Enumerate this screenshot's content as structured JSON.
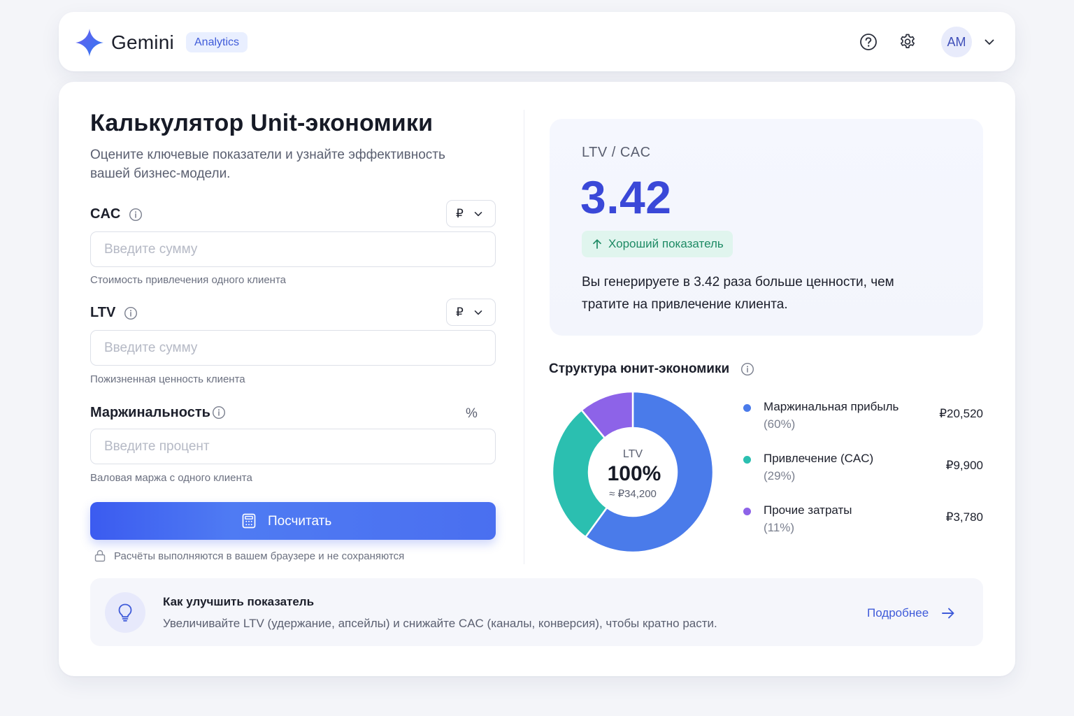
{
  "header": {
    "brand": "Gemini",
    "badge": "Analytics",
    "avatar_initials": "AM",
    "icons": [
      "sparkle-star-icon",
      "help-circle-icon",
      "gear-icon",
      "chevron-down-icon"
    ]
  },
  "calculator": {
    "title": "Калькулятор Unit-экономики",
    "subtitle": "Оцените ключевые показатели и узнайте эффективность вашей бизнес-модели.",
    "fields": [
      {
        "label": "CAC",
        "currency": "₽",
        "value": "",
        "placeholder": "Введите сумму",
        "hint": "Стоимость привлечения одного клиента"
      },
      {
        "label": "LTV",
        "currency": "₽",
        "value": "",
        "placeholder": "Введите сумму",
        "hint": "Пожизненная ценность клиента"
      },
      {
        "label": "Маржинальность",
        "unit": "%",
        "value": "",
        "placeholder": "Введите процент",
        "hint": "Валовая маржа с одного клиента"
      }
    ],
    "button_label": "Посчитать",
    "privacy_note": "Расчёты выполняются в вашем браузере и не сохраняются"
  },
  "result": {
    "label": "LTV / CAC",
    "value": "3.42",
    "status": "Хороший показатель",
    "description": "Вы генерируете в 3.42 раза больше ценности, чем тратите на привлечение клиента."
  },
  "structure": {
    "title": "Структура юнит-экономики",
    "center_label": "LTV",
    "center_value": "100%",
    "center_sub": "≈ ₽34,200"
  },
  "chart_data": {
    "type": "pie",
    "categories": [
      "Маржинальная прибыль",
      "Привлечение (CAC)",
      "Прочие затраты"
    ],
    "values": [
      60,
      29,
      11
    ],
    "amounts": [
      "₽20,520",
      "₽9,900",
      "₽3,780"
    ],
    "percent_labels": [
      "(60%)",
      "(29%)",
      "(11%)"
    ],
    "colors": [
      "#4a7bea",
      "#2bbfb0",
      "#8d63e8"
    ],
    "legend": "right",
    "donut": true
  },
  "tip": {
    "title": "Как улучшить показатель",
    "text": "Увеличивайте LTV (удержание, апсейлы) и снижайте CAC (каналы, конверсия), чтобы кратно расти.",
    "link": "Подробнее"
  }
}
